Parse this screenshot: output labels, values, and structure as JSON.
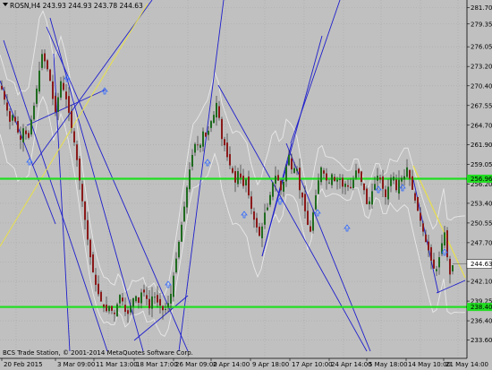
{
  "colors": {
    "background": "#c0c0c0",
    "grid": "#a8a8a8",
    "bull": "#1f6b1f",
    "bear": "#8b1a1a",
    "wick": "#202020",
    "band": "#e8e8e8",
    "trendline": "#1e1ecc",
    "level_line": "#22dd22",
    "diagonal_yellow": "#e8e04a",
    "price_tag_bg": "#ffffff",
    "level_tag_bg": "#22dd22",
    "arrow": "#2f68ff"
  },
  "header": {
    "symbol_title": "ROSN,H4 243.93 244.93 243.78 244.63"
  },
  "footer": {
    "copyright": "BCS Trade Station, © 2001-2014 MetaQuotes Software Corp."
  },
  "price_tag": {
    "value": "244.63"
  },
  "levels": [
    {
      "label": "256.96",
      "value": 256.96
    },
    {
      "label": "238.40",
      "value": 238.4
    }
  ],
  "chart_data": {
    "type": "candlestick",
    "symbol": "ROSN",
    "timeframe": "H4",
    "ylim": [
      232.0,
      282.3
    ],
    "y_ticks": [
      "281.70",
      "279.35",
      "276.05",
      "273.20",
      "270.40",
      "267.55",
      "264.70",
      "261.90",
      "259.05",
      "256.20",
      "253.40",
      "250.55",
      "247.70",
      "244.90",
      "242.10",
      "239.25",
      "236.40",
      "233.60"
    ],
    "y_tick_values": [
      281.7,
      279.35,
      276.05,
      273.2,
      270.4,
      267.55,
      264.7,
      261.9,
      259.05,
      256.2,
      253.4,
      250.55,
      247.7,
      244.9,
      242.1,
      239.25,
      236.4,
      233.6
    ],
    "x_ticks": [
      "20 Feb 2015",
      "3 Mar 09:00",
      "11 Mar 13:00",
      "18 Mar 17:00",
      "26 Mar 09:00",
      "2 Apr 14:00",
      "9 Apr 18:00",
      "17 Apr 10:00",
      "24 Apr 14:00",
      "5 May 18:00",
      "14 May 10:00",
      "21 May 14:00"
    ],
    "close_path": [
      [
        0,
        270.4
      ],
      [
        5,
        267.9
      ],
      [
        10,
        265.2
      ],
      [
        14,
        266.5
      ],
      [
        18,
        264.0
      ],
      [
        22,
        262.6
      ],
      [
        26,
        264.8
      ],
      [
        30,
        262.0
      ],
      [
        34,
        265.5
      ],
      [
        38,
        268.2
      ],
      [
        42,
        271.8
      ],
      [
        46,
        275.0
      ],
      [
        50,
        273.6
      ],
      [
        54,
        272.0
      ],
      [
        58,
        268.5
      ],
      [
        62,
        266.0
      ],
      [
        66,
        271.5
      ],
      [
        70,
        269.8
      ],
      [
        74,
        268.0
      ],
      [
        78,
        265.0
      ],
      [
        82,
        262.2
      ],
      [
        86,
        258.8
      ],
      [
        90,
        254.6
      ],
      [
        94,
        251.0
      ],
      [
        98,
        247.2
      ],
      [
        102,
        244.0
      ],
      [
        106,
        241.6
      ],
      [
        110,
        239.8
      ],
      [
        114,
        238.6
      ],
      [
        118,
        237.8
      ],
      [
        122,
        238.8
      ],
      [
        126,
        236.9
      ],
      [
        130,
        238.8
      ],
      [
        134,
        240.6
      ],
      [
        138,
        237.8
      ],
      [
        142,
        237.4
      ],
      [
        146,
        239.0
      ],
      [
        150,
        240.3
      ],
      [
        154,
        239.0
      ],
      [
        158,
        241.0
      ],
      [
        162,
        240.0
      ],
      [
        166,
        238.2
      ],
      [
        170,
        240.5
      ],
      [
        174,
        239.2
      ],
      [
        178,
        238.6
      ],
      [
        182,
        237.7
      ],
      [
        186,
        238.5
      ],
      [
        190,
        240.3
      ],
      [
        194,
        243.8
      ],
      [
        198,
        247.0
      ],
      [
        202,
        250.3
      ],
      [
        206,
        253.8
      ],
      [
        210,
        257.6
      ],
      [
        214,
        260.4
      ],
      [
        218,
        262.5
      ],
      [
        222,
        261.2
      ],
      [
        226,
        263.8
      ],
      [
        230,
        262.8
      ],
      [
        234,
        265.0
      ],
      [
        238,
        266.2
      ],
      [
        242,
        268.5
      ],
      [
        246,
        263.0
      ],
      [
        250,
        261.8
      ],
      [
        254,
        259.5
      ],
      [
        258,
        258.3
      ],
      [
        262,
        256.4
      ],
      [
        266,
        258.6
      ],
      [
        270,
        255.6
      ],
      [
        274,
        256.8
      ],
      [
        278,
        253.8
      ],
      [
        282,
        251.4
      ],
      [
        286,
        249.9
      ],
      [
        290,
        248.3
      ],
      [
        294,
        251.8
      ],
      [
        298,
        252.8
      ],
      [
        302,
        255.2
      ],
      [
        306,
        257.6
      ],
      [
        310,
        256.7
      ],
      [
        314,
        254.8
      ],
      [
        318,
        258.2
      ],
      [
        322,
        260.4
      ],
      [
        326,
        257.6
      ],
      [
        330,
        259.4
      ],
      [
        334,
        255.3
      ],
      [
        338,
        253.9
      ],
      [
        342,
        250.6
      ],
      [
        346,
        249.3
      ],
      [
        350,
        253.0
      ],
      [
        354,
        256.1
      ],
      [
        358,
        258.6
      ],
      [
        362,
        257.4
      ],
      [
        366,
        256.0
      ],
      [
        370,
        257.6
      ],
      [
        374,
        256.3
      ],
      [
        378,
        257.3
      ],
      [
        382,
        255.8
      ],
      [
        386,
        256.4
      ],
      [
        390,
        255.2
      ],
      [
        394,
        256.8
      ],
      [
        398,
        258.6
      ],
      [
        402,
        256.9
      ],
      [
        406,
        255.3
      ],
      [
        410,
        252.6
      ],
      [
        414,
        254.8
      ],
      [
        418,
        256.2
      ],
      [
        422,
        257.8
      ],
      [
        426,
        255.9
      ],
      [
        430,
        254.3
      ],
      [
        434,
        256.3
      ],
      [
        438,
        257.9
      ],
      [
        442,
        255.3
      ],
      [
        446,
        257.3
      ],
      [
        450,
        256.9
      ],
      [
        454,
        258.6
      ],
      [
        458,
        256.4
      ],
      [
        462,
        254.3
      ],
      [
        466,
        252.3
      ],
      [
        470,
        250.4
      ],
      [
        474,
        248.2
      ],
      [
        478,
        246.6
      ],
      [
        482,
        244.6
      ],
      [
        486,
        243.3
      ],
      [
        490,
        245.6
      ],
      [
        494,
        248.3
      ],
      [
        496,
        249.2
      ],
      [
        498,
        246.6
      ],
      [
        500,
        244.6
      ],
      [
        502,
        243.1
      ],
      [
        504,
        244.3
      ],
      [
        506,
        244.6
      ]
    ],
    "last_price": 244.63,
    "horizontal_levels": [
      256.96,
      238.4
    ],
    "grid": true
  }
}
